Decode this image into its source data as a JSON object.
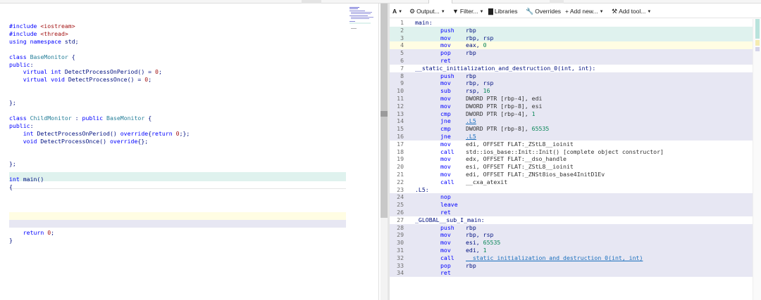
{
  "editor": {
    "lines": [
      {
        "segments": [
          {
            "t": "#include ",
            "c": "k"
          },
          {
            "t": "<iostream>",
            "c": "s"
          }
        ]
      },
      {
        "segments": [
          {
            "t": "#include ",
            "c": "k"
          },
          {
            "t": "<thread>",
            "c": "s"
          }
        ]
      },
      {
        "segments": [
          {
            "t": "using namespace ",
            "c": "k"
          },
          {
            "t": "std;",
            "c": "c"
          }
        ]
      },
      {
        "segments": []
      },
      {
        "segments": [
          {
            "t": "class ",
            "c": "k"
          },
          {
            "t": "BaseMonitor ",
            "c": "t"
          },
          {
            "t": "{",
            "c": "c"
          }
        ]
      },
      {
        "segments": [
          {
            "t": "public",
            "c": "k"
          },
          {
            "t": ":",
            "c": "c"
          }
        ]
      },
      {
        "segments": [
          {
            "t": "    virtual int ",
            "c": "k"
          },
          {
            "t": "DetectProcessOnPeriod() = ",
            "c": "c"
          },
          {
            "t": "0",
            "c": "s"
          },
          {
            "t": ";",
            "c": "c"
          }
        ]
      },
      {
        "segments": [
          {
            "t": "    virtual void ",
            "c": "k"
          },
          {
            "t": "DetectProcessOnce() = ",
            "c": "c"
          },
          {
            "t": "0",
            "c": "s"
          },
          {
            "t": ";",
            "c": "c"
          }
        ]
      },
      {
        "segments": []
      },
      {
        "segments": []
      },
      {
        "segments": [
          {
            "t": "};",
            "c": "c"
          }
        ]
      },
      {
        "segments": []
      },
      {
        "segments": [
          {
            "t": "class ",
            "c": "k"
          },
          {
            "t": "ChildMonitor ",
            "c": "t"
          },
          {
            "t": ": ",
            "c": "c"
          },
          {
            "t": "public ",
            "c": "k"
          },
          {
            "t": "BaseMonitor ",
            "c": "t"
          },
          {
            "t": "{",
            "c": "c"
          }
        ]
      },
      {
        "segments": [
          {
            "t": "public",
            "c": "k"
          },
          {
            "t": ":",
            "c": "c"
          }
        ]
      },
      {
        "segments": [
          {
            "t": "    int ",
            "c": "k"
          },
          {
            "t": "DetectProcessOnPeriod() ",
            "c": "c"
          },
          {
            "t": "override",
            "c": "k"
          },
          {
            "t": "{",
            "c": "c"
          },
          {
            "t": "return ",
            "c": "k"
          },
          {
            "t": "0",
            "c": "s"
          },
          {
            "t": ";};",
            "c": "c"
          }
        ]
      },
      {
        "segments": [
          {
            "t": "    void ",
            "c": "k"
          },
          {
            "t": "DetectProcessOnce() ",
            "c": "c"
          },
          {
            "t": "override",
            "c": "k"
          },
          {
            "t": "{};",
            "c": "c"
          }
        ]
      },
      {
        "segments": []
      },
      {
        "segments": []
      },
      {
        "segments": [
          {
            "t": "};",
            "c": "c"
          }
        ]
      },
      {
        "segments": []
      },
      {
        "segments": [
          {
            "t": "int ",
            "c": "k"
          },
          {
            "t": "main()",
            "c": "c"
          }
        ]
      },
      {
        "segments": [
          {
            "t": "{",
            "c": "c"
          }
        ]
      },
      {
        "segments": []
      },
      {
        "segments": []
      },
      {
        "segments": []
      },
      {
        "segments": []
      },
      {
        "segments": []
      },
      {
        "segments": [
          {
            "t": "    return ",
            "c": "k"
          },
          {
            "t": "0",
            "c": "s"
          },
          {
            "t": ";",
            "c": "c"
          }
        ]
      },
      {
        "segments": [
          {
            "t": "}",
            "c": "c"
          }
        ]
      }
    ]
  },
  "toolbar": {
    "font_button": "A",
    "output_label": "Output...",
    "filter_label": "Filter...",
    "libraries_label": "Libraries",
    "overrides_label": "Overrides",
    "add_new_label": "+ Add new...",
    "add_tool_label": "Add tool..."
  },
  "assembly": {
    "rows": [
      {
        "n": "1",
        "label": "main:"
      },
      {
        "n": "2",
        "op": "push",
        "args": [
          {
            "t": "rbp",
            "k": "reg"
          }
        ]
      },
      {
        "n": "3",
        "op": "mov",
        "args": [
          {
            "t": "rbp, rsp",
            "k": "reg"
          }
        ]
      },
      {
        "n": "4",
        "op": "mov",
        "args": [
          {
            "t": "eax, ",
            "k": "reg"
          },
          {
            "t": "0",
            "k": "num"
          }
        ]
      },
      {
        "n": "5",
        "op": "pop",
        "args": [
          {
            "t": "rbp",
            "k": "reg"
          }
        ]
      },
      {
        "n": "6",
        "op": "ret"
      },
      {
        "n": "7",
        "label": "__static_initialization_and_destruction_0(int, int):"
      },
      {
        "n": "8",
        "op": "push",
        "args": [
          {
            "t": "rbp",
            "k": "reg"
          }
        ]
      },
      {
        "n": "9",
        "op": "mov",
        "args": [
          {
            "t": "rbp, rsp",
            "k": "reg"
          }
        ]
      },
      {
        "n": "10",
        "op": "sub",
        "args": [
          {
            "t": "rsp, ",
            "k": "reg"
          },
          {
            "t": "16",
            "k": "num"
          }
        ]
      },
      {
        "n": "11",
        "op": "mov",
        "args": [
          {
            "t": "DWORD PTR [rbp-4], edi",
            "k": "plain"
          }
        ]
      },
      {
        "n": "12",
        "op": "mov",
        "args": [
          {
            "t": "DWORD PTR [rbp-8], esi",
            "k": "plain"
          }
        ]
      },
      {
        "n": "13",
        "op": "cmp",
        "args": [
          {
            "t": "DWORD PTR [rbp-4], ",
            "k": "plain"
          },
          {
            "t": "1",
            "k": "num"
          }
        ]
      },
      {
        "n": "14",
        "op": "jne",
        "args": [
          {
            "t": ".L5",
            "k": "sym"
          }
        ]
      },
      {
        "n": "15",
        "op": "cmp",
        "args": [
          {
            "t": "DWORD PTR [rbp-8], ",
            "k": "plain"
          },
          {
            "t": "65535",
            "k": "num"
          }
        ]
      },
      {
        "n": "16",
        "op": "jne",
        "args": [
          {
            "t": ".L5",
            "k": "sym"
          }
        ]
      },
      {
        "n": "17",
        "op": "mov",
        "args": [
          {
            "t": "edi, OFFSET FLAT:_ZStL8__ioinit",
            "k": "plain"
          }
        ]
      },
      {
        "n": "18",
        "op": "call",
        "args": [
          {
            "t": "std::ios_base::Init::Init() [complete object constructor]",
            "k": "plain"
          }
        ]
      },
      {
        "n": "19",
        "op": "mov",
        "args": [
          {
            "t": "edx, OFFSET FLAT:__dso_handle",
            "k": "plain"
          }
        ]
      },
      {
        "n": "20",
        "op": "mov",
        "args": [
          {
            "t": "esi, OFFSET FLAT:_ZStL8__ioinit",
            "k": "plain"
          }
        ]
      },
      {
        "n": "21",
        "op": "mov",
        "args": [
          {
            "t": "edi, OFFSET FLAT:_ZNSt8ios_base4InitD1Ev",
            "k": "plain"
          }
        ]
      },
      {
        "n": "22",
        "op": "call",
        "args": [
          {
            "t": "__cxa_atexit",
            "k": "plain"
          }
        ]
      },
      {
        "n": "23",
        "label": ".L5:"
      },
      {
        "n": "24",
        "op": "nop"
      },
      {
        "n": "25",
        "op": "leave"
      },
      {
        "n": "26",
        "op": "ret"
      },
      {
        "n": "27",
        "label": "_GLOBAL__sub_I_main:"
      },
      {
        "n": "28",
        "op": "push",
        "args": [
          {
            "t": "rbp",
            "k": "reg"
          }
        ]
      },
      {
        "n": "29",
        "op": "mov",
        "args": [
          {
            "t": "rbp, rsp",
            "k": "reg"
          }
        ]
      },
      {
        "n": "30",
        "op": "mov",
        "args": [
          {
            "t": "esi, ",
            "k": "reg"
          },
          {
            "t": "65535",
            "k": "num"
          }
        ]
      },
      {
        "n": "31",
        "op": "mov",
        "args": [
          {
            "t": "edi, ",
            "k": "reg"
          },
          {
            "t": "1",
            "k": "num"
          }
        ]
      },
      {
        "n": "32",
        "op": "call",
        "args": [
          {
            "t": "__static_initialization_and_destruction_0(int, int)",
            "k": "sym"
          }
        ]
      },
      {
        "n": "33",
        "op": "pop",
        "args": [
          {
            "t": "rbp",
            "k": "reg"
          }
        ]
      },
      {
        "n": "34",
        "op": "ret"
      }
    ]
  },
  "colors": {
    "highlight_teal": "#dff2ee",
    "highlight_yellow": "#fffde3",
    "highlight_lavender": "#e7e7f3",
    "keyword": "#0000ff",
    "string": "#a31515",
    "type": "#267f99"
  }
}
